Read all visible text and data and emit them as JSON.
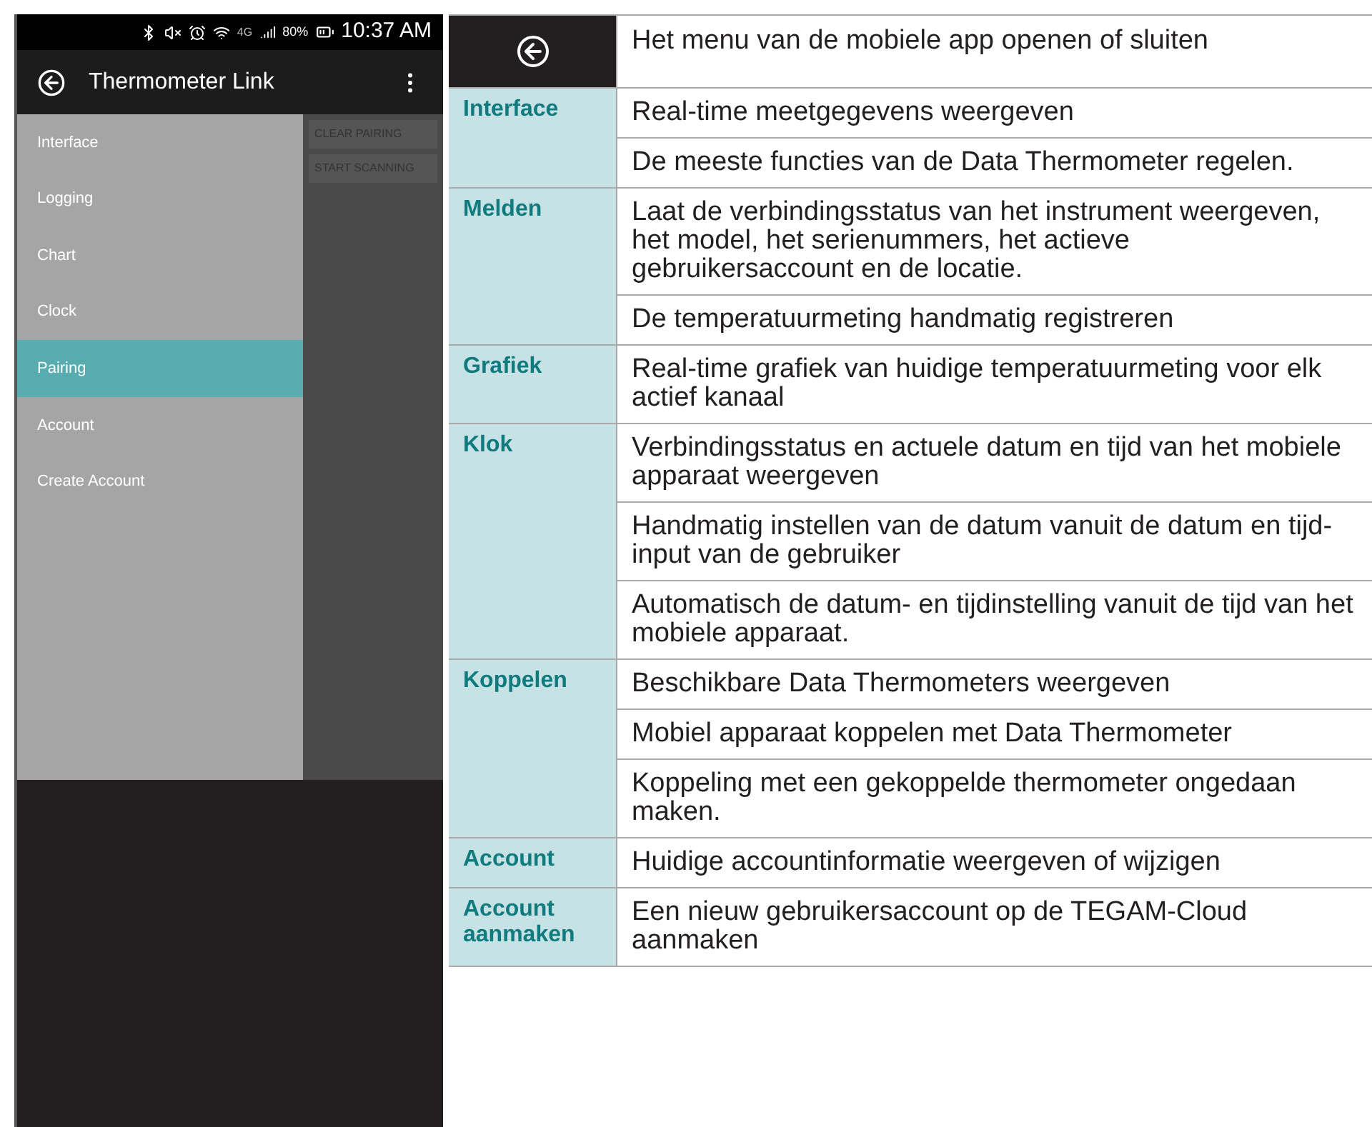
{
  "phone": {
    "status_bar": {
      "network": "4G",
      "battery": "80%",
      "time": "10:37 AM"
    },
    "app_bar": {
      "title": "Thermometer Link"
    },
    "background_buttons": [
      "CLEAR PAIRING",
      "START SCANNING"
    ],
    "drawer": {
      "items": [
        {
          "label": "Interface",
          "selected": false
        },
        {
          "label": "Logging",
          "selected": false
        },
        {
          "label": "Chart",
          "selected": false
        },
        {
          "label": "Clock",
          "selected": false
        },
        {
          "label": "Pairing",
          "selected": true
        },
        {
          "label": "Account",
          "selected": false
        },
        {
          "label": "Create Account",
          "selected": false
        }
      ]
    }
  },
  "table": {
    "header": {
      "description": "Het menu van de mobiele app openen of sluiten"
    },
    "groups": [
      {
        "label": "Interface",
        "descriptions": [
          "Real-time meetgegevens weergeven",
          "De meeste functies van de Data Thermometer regelen."
        ]
      },
      {
        "label": "Melden",
        "descriptions": [
          "Laat de verbindingsstatus van het instrument weergeven, het model, het serienummers, het actieve gebruikersaccount en de locatie.",
          "De temperatuurmeting handmatig registreren"
        ]
      },
      {
        "label": "Grafiek",
        "descriptions": [
          "Real-time grafiek van huidige temperatuurmeting voor elk actief kanaal"
        ]
      },
      {
        "label": "Klok",
        "descriptions": [
          "Verbindingsstatus en actuele datum en tijd van het mobiele apparaat weergeven",
          "Handmatig instellen van de datum vanuit de datum en tijd-input van de gebruiker",
          "Automatisch de datum- en tijdinstelling vanuit de tijd van het mobiele apparaat."
        ]
      },
      {
        "label": "Koppelen",
        "descriptions": [
          "Beschikbare Data Thermometers weergeven",
          "Mobiel apparaat koppelen met Data Thermometer",
          "Koppeling met een gekoppelde thermometer ongedaan maken."
        ]
      },
      {
        "label": "Account",
        "descriptions": [
          "Huidige accountinformatie weergeven of wijzigen"
        ]
      },
      {
        "label": "Account aanmaken",
        "descriptions": [
          "Een nieuw gebruikersaccount op de TEGAM-Cloud aanmaken"
        ]
      }
    ]
  }
}
